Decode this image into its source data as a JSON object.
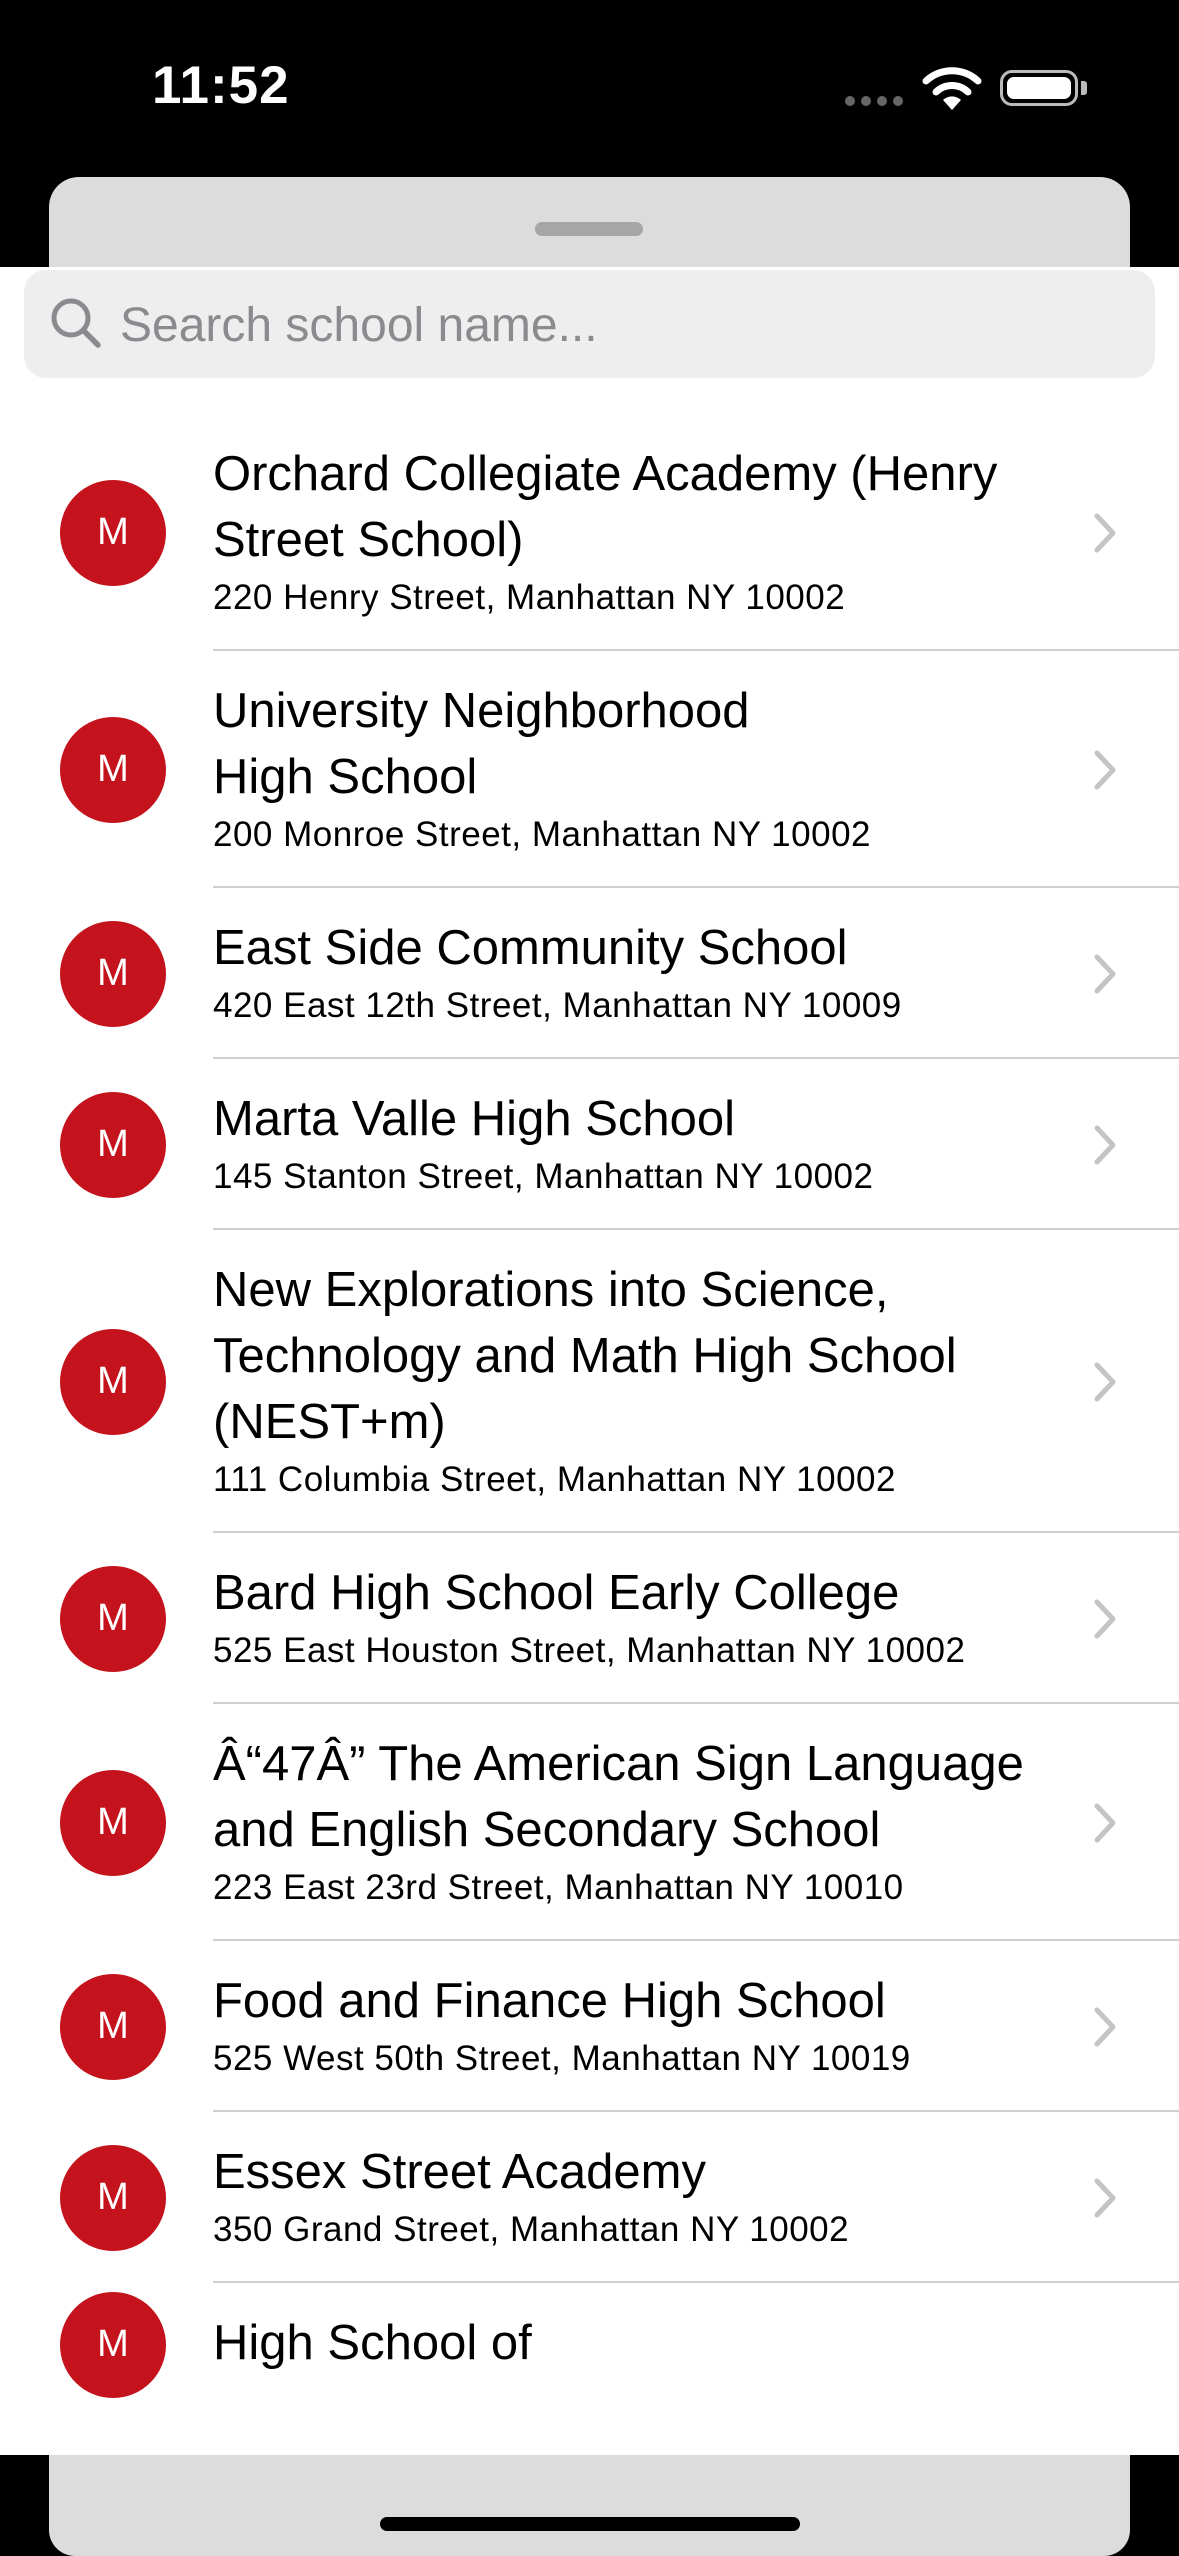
{
  "status_bar": {
    "time": "11:52",
    "icons": [
      "cellular-signal-icon",
      "wifi-icon",
      "battery-icon"
    ]
  },
  "colors": {
    "accent": "#c4131c",
    "search_background": "#eeeeef",
    "placeholder": "#8b8b8f",
    "divider": "#cfcfd2"
  },
  "search": {
    "placeholder": "Search school name...",
    "value": ""
  },
  "schools": [
    {
      "initial": "M",
      "name_lines": [
        "Orchard Collegiate Academy (Henry",
        "Street School)"
      ],
      "address": "220 Henry Street, Manhattan NY 10002"
    },
    {
      "initial": "M",
      "name_lines": [
        "University Neighborhood",
        "High School"
      ],
      "address": "200 Monroe Street, Manhattan NY 10002"
    },
    {
      "initial": "M",
      "name_lines": [
        "East Side Community School"
      ],
      "address": "420 East 12th Street, Manhattan NY 10009"
    },
    {
      "initial": "M",
      "name_lines": [
        "Marta Valle High School"
      ],
      "address": "145 Stanton Street, Manhattan NY 10002"
    },
    {
      "initial": "M",
      "name_lines": [
        "New Explorations into Science,",
        "Technology and Math High School",
        "(NEST+m)"
      ],
      "address": "111 Columbia Street, Manhattan NY 10002"
    },
    {
      "initial": "M",
      "name_lines": [
        "Bard High School Early College"
      ],
      "address": "525 East Houston Street, Manhattan NY 10002"
    },
    {
      "initial": "M",
      "name_lines": [
        "Â“47Â” The American Sign Language",
        "and English Secondary School"
      ],
      "address": "223 East 23rd Street, Manhattan NY 10010"
    },
    {
      "initial": "M",
      "name_lines": [
        "Food and Finance High School"
      ],
      "address": "525 West 50th Street, Manhattan NY 10019"
    },
    {
      "initial": "M",
      "name_lines": [
        "Essex Street Academy"
      ],
      "address": "350 Grand Street, Manhattan NY 10002"
    },
    {
      "initial": "M",
      "name_lines": [
        "High School of"
      ],
      "address": ""
    }
  ]
}
